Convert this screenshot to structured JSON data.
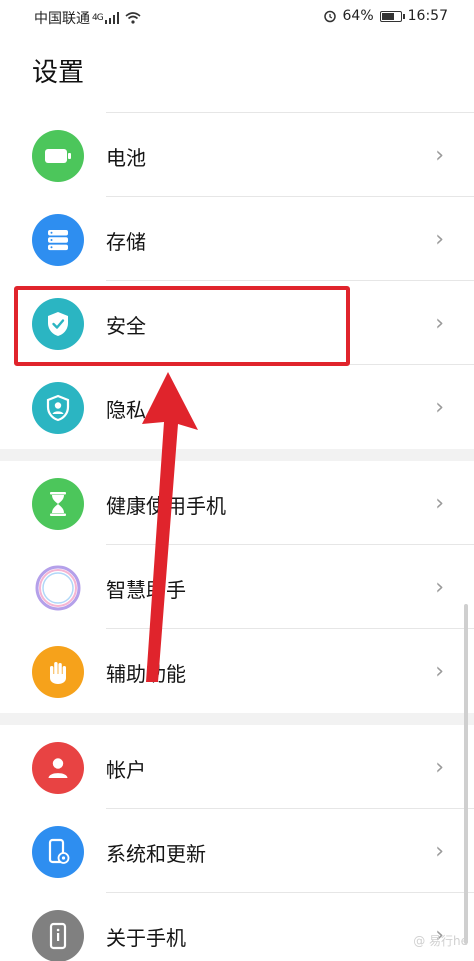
{
  "status_bar": {
    "carrier": "中国联通",
    "network": "4G",
    "battery_percent": "64%",
    "time": "16:57"
  },
  "page_title": "设置",
  "groups": [
    [
      {
        "label": "电池",
        "icon": "battery-icon",
        "color": "#4cc65b"
      },
      {
        "label": "存储",
        "icon": "storage-icon",
        "color": "#2e8ef0"
      },
      {
        "label": "安全",
        "icon": "shield-icon",
        "color": "#2bb5c2"
      },
      {
        "label": "隐私",
        "icon": "privacy-icon",
        "color": "#2bb5c2"
      }
    ],
    [
      {
        "label": "健康使用手机",
        "icon": "hourglass-icon",
        "color": "#4cc65b"
      },
      {
        "label": "智慧助手",
        "icon": "assistant-icon",
        "color": "#b4a0ea"
      },
      {
        "label": "辅助功能",
        "icon": "hand-icon",
        "color": "#f6a21b"
      }
    ],
    [
      {
        "label": "帐户",
        "icon": "account-icon",
        "color": "#e84343"
      },
      {
        "label": "系统和更新",
        "icon": "system-update-icon",
        "color": "#2e8ef0"
      },
      {
        "label": "关于手机",
        "icon": "about-phone-icon",
        "color": "#808080"
      }
    ]
  ],
  "chevron": "›",
  "watermark": "@ 易行he"
}
